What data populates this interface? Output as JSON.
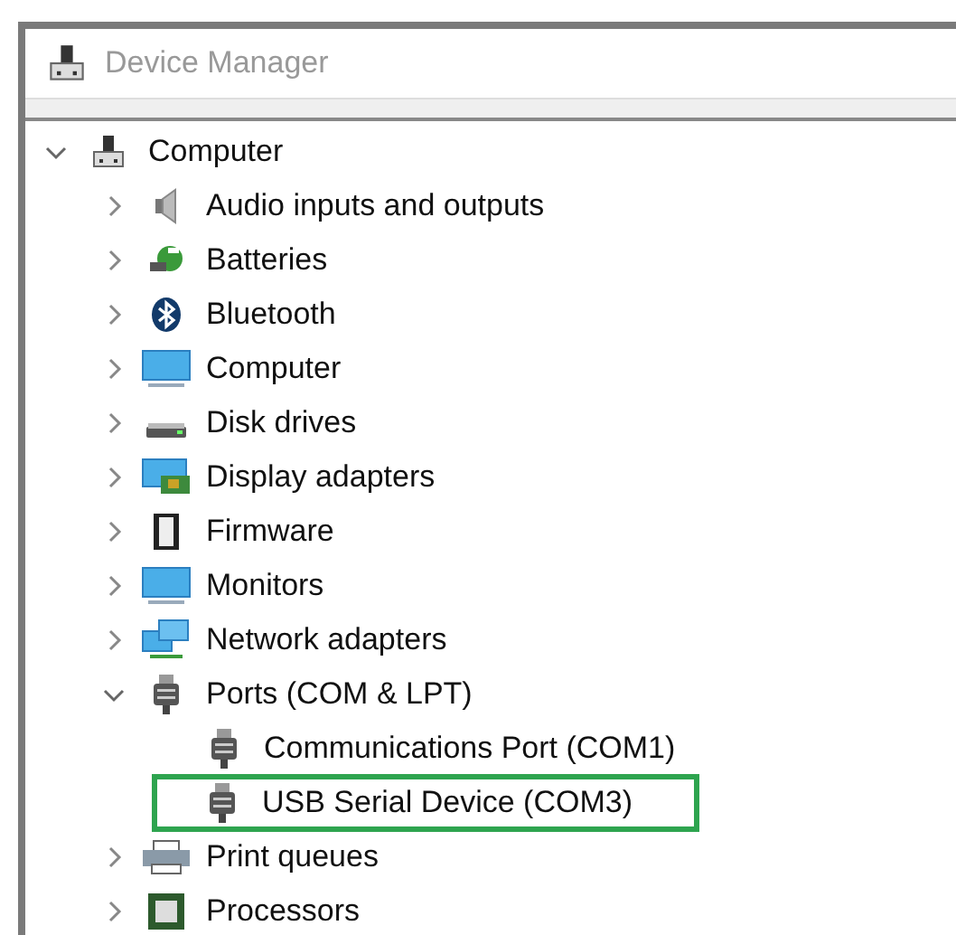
{
  "window": {
    "title": "Device Manager"
  },
  "tree": [
    {
      "label": "Computer",
      "kind": "computer-root",
      "expanded": true,
      "children": [
        {
          "label": "Audio inputs and outputs",
          "kind": "speaker",
          "expanded": false
        },
        {
          "label": "Batteries",
          "kind": "battery",
          "expanded": false
        },
        {
          "label": "Bluetooth",
          "kind": "bluetooth",
          "expanded": false
        },
        {
          "label": "Computer",
          "kind": "monitor",
          "expanded": false
        },
        {
          "label": "Disk drives",
          "kind": "disk",
          "expanded": false
        },
        {
          "label": "Display adapters",
          "kind": "adapter",
          "expanded": false
        },
        {
          "label": "Firmware",
          "kind": "chip",
          "expanded": false
        },
        {
          "label": "Monitors",
          "kind": "monitor",
          "expanded": false
        },
        {
          "label": "Network adapters",
          "kind": "network",
          "expanded": false
        },
        {
          "label": "Ports (COM & LPT)",
          "kind": "port",
          "expanded": true,
          "children": [
            {
              "label": "Communications Port (COM1)",
              "kind": "port",
              "highlighted": false
            },
            {
              "label": "USB Serial Device (COM3)",
              "kind": "port",
              "highlighted": true
            }
          ]
        },
        {
          "label": "Print queues",
          "kind": "printer",
          "expanded": false
        },
        {
          "label": "Processors",
          "kind": "processor",
          "expanded": false
        }
      ]
    }
  ]
}
